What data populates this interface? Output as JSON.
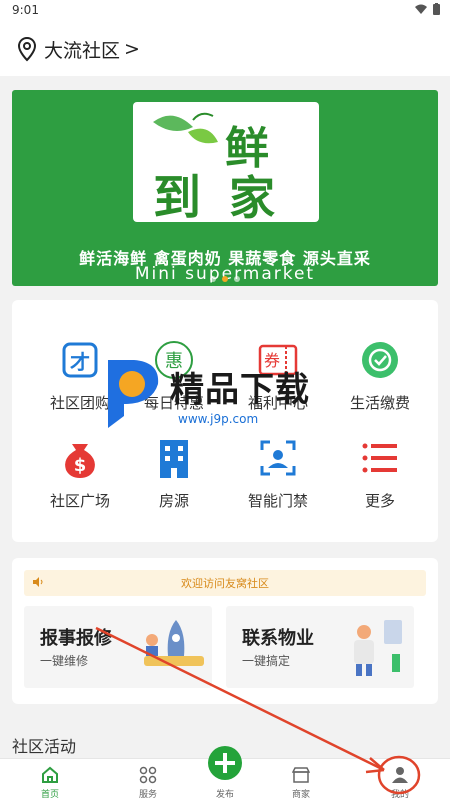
{
  "status_bar": {
    "time": "9:01"
  },
  "header": {
    "community_name": "大流社区",
    "chevron": ">"
  },
  "banner": {
    "slogan": "鲜活海鲜 禽蛋肉奶 果蔬零食 源头直采",
    "subtitle": "Mini supermarket",
    "logo_chars": [
      "鲜",
      "到",
      "家"
    ]
  },
  "services": [
    {
      "label": "社区团购",
      "icon": "group-buy-icon",
      "color": "#1f7ad6"
    },
    {
      "label": "每日特惠",
      "icon": "discount-icon",
      "color": "#2e9e41"
    },
    {
      "label": "福利中心",
      "icon": "coupon-icon",
      "color": "#e53935"
    },
    {
      "label": "生活缴费",
      "icon": "payment-icon",
      "color": "#3cbf6b"
    },
    {
      "label": "社区广场",
      "icon": "money-bag-icon",
      "color": "#e53935"
    },
    {
      "label": "房源",
      "icon": "building-icon",
      "color": "#1f7ad6"
    },
    {
      "label": "智能门禁",
      "icon": "face-scan-icon",
      "color": "#1f7ad6"
    },
    {
      "label": "更多",
      "icon": "list-icon",
      "color": "#e53935"
    }
  ],
  "watermark": {
    "text": "精品下载",
    "url": "www.j9p.com"
  },
  "notice": {
    "text": "欢迎访问友窝社区"
  },
  "features": [
    {
      "title": "报事报修",
      "subtitle": "一键维修"
    },
    {
      "title": "联系物业",
      "subtitle": "一键搞定"
    }
  ],
  "section": {
    "title": "社区活动"
  },
  "tabbar": {
    "tabs": [
      {
        "label": "首页",
        "icon": "home-icon"
      },
      {
        "label": "服务",
        "icon": "grid-icon"
      },
      {
        "label": "发布",
        "icon": "plus-icon"
      },
      {
        "label": "商家",
        "icon": "store-icon"
      },
      {
        "label": "我的",
        "icon": "person-icon"
      }
    ],
    "active_index": 0
  },
  "colors": {
    "primary": "#2e9e41",
    "accent": "#f5a623",
    "annotation": "#e0442b"
  }
}
